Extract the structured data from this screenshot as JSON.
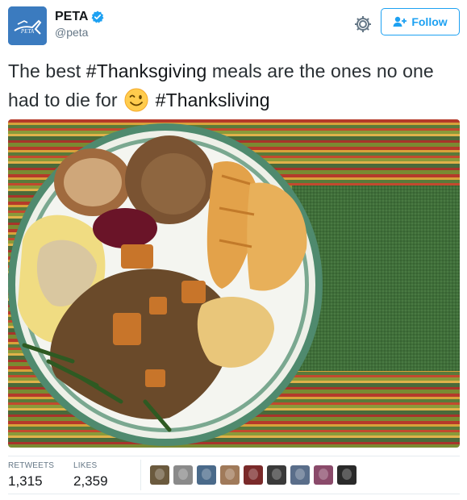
{
  "user": {
    "display_name": "PETA",
    "handle": "@peta",
    "avatar_text": "PETA",
    "verified_icon": "verified-badge-icon"
  },
  "actions": {
    "settings_icon": "gear-icon",
    "follow_label": "Follow",
    "follow_icon": "add-user-icon"
  },
  "tweet": {
    "text_before": "The best ",
    "hashtag1": "#Thanksgiving",
    "text_middle": " meals are the ones no one had to die for ",
    "emoji": "winking-face-emoji",
    "hashtag2": "#Thanksliving"
  },
  "media": {
    "icon": "thanksgiving-plate-photo"
  },
  "stats": {
    "retweets_label": "RETWEETS",
    "retweets_value": "1,315",
    "likes_label": "LIKES",
    "likes_value": "2,359"
  },
  "likers": [
    {
      "color": "#6b5a3e"
    },
    {
      "color": "#8a8a8a"
    },
    {
      "color": "#4a6a8a"
    },
    {
      "color": "#a07a5a"
    },
    {
      "color": "#7a2a2a"
    },
    {
      "color": "#3a3a3a"
    },
    {
      "color": "#5a6e8a"
    },
    {
      "color": "#8a4a6a"
    },
    {
      "color": "#2a2a2a"
    }
  ],
  "colors": {
    "brand_blue": "#1da1f2",
    "avatar_bg": "#3b7bbf"
  }
}
